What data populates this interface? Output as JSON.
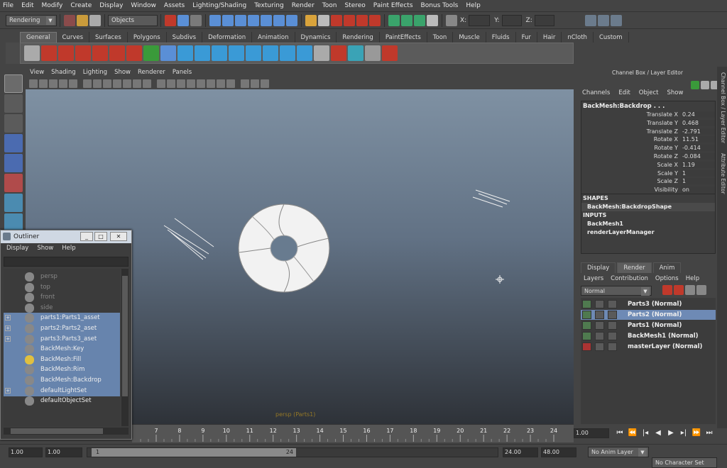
{
  "menubar": [
    "File",
    "Edit",
    "Modify",
    "Create",
    "Display",
    "Window",
    "Assets",
    "Lighting/Shading",
    "Texturing",
    "Render",
    "Toon",
    "Stereo",
    "Paint Effects",
    "Bonus Tools",
    "Help"
  ],
  "status": {
    "mode": "Rendering",
    "selection_mask": "Objects",
    "x_label": "X:",
    "y_label": "Y:",
    "z_label": "Z:"
  },
  "shelf_tabs": [
    "General",
    "Curves",
    "Surfaces",
    "Polygons",
    "Subdivs",
    "Deformation",
    "Animation",
    "Dynamics",
    "Rendering",
    "PaintEffects",
    "Toon",
    "Muscle",
    "Fluids",
    "Fur",
    "Hair",
    "nCloth",
    "Custom"
  ],
  "viewport": {
    "menu": [
      "View",
      "Shading",
      "Lighting",
      "Show",
      "Renderer",
      "Panels"
    ],
    "camera_label": "persp (Parts1)"
  },
  "channel_box": {
    "title": "Channel Box / Layer Editor",
    "menu": [
      "Channels",
      "Edit",
      "Object",
      "Show"
    ],
    "object": "BackMesh:Backdrop . . .",
    "attrs": [
      {
        "name": "Translate X",
        "value": "0.24"
      },
      {
        "name": "Translate Y",
        "value": "0.468"
      },
      {
        "name": "Translate Z",
        "value": "-2.791"
      },
      {
        "name": "Rotate X",
        "value": "11.51"
      },
      {
        "name": "Rotate Y",
        "value": "-0.414"
      },
      {
        "name": "Rotate Z",
        "value": "-0.084"
      },
      {
        "name": "Scale X",
        "value": "1.19"
      },
      {
        "name": "Scale Y",
        "value": "1"
      },
      {
        "name": "Scale Z",
        "value": "1"
      },
      {
        "name": "Visibility",
        "value": "on"
      }
    ],
    "shapes_header": "SHAPES",
    "shape": "BackMesh:BackdropShape",
    "inputs_header": "INPUTS",
    "inputs": [
      "BackMesh1",
      "renderLayerManager"
    ]
  },
  "side_tabs": [
    "Channel Box / Layer Editor",
    "Attribute Editor"
  ],
  "layer_editor": {
    "tabs": [
      "Display",
      "Render",
      "Anim"
    ],
    "active_tab": "Render",
    "menu": [
      "Layers",
      "Contribution",
      "Options",
      "Help"
    ],
    "blend_mode": "Normal",
    "layers": [
      {
        "name": "Parts3 (Normal)",
        "selected": false
      },
      {
        "name": "Parts2 (Normal)",
        "selected": true
      },
      {
        "name": "Parts1 (Normal)",
        "selected": false
      },
      {
        "name": "BackMesh1 (Normal)",
        "selected": false
      },
      {
        "name": "masterLayer (Normal)",
        "selected": false
      }
    ]
  },
  "outliner": {
    "title": "Outliner",
    "menu": [
      "Display",
      "Show",
      "Help"
    ],
    "items": [
      {
        "name": "persp",
        "selected": false,
        "dim": true,
        "expandable": false
      },
      {
        "name": "top",
        "selected": false,
        "dim": true,
        "expandable": false
      },
      {
        "name": "front",
        "selected": false,
        "dim": true,
        "expandable": false
      },
      {
        "name": "side",
        "selected": false,
        "dim": true,
        "expandable": false
      },
      {
        "name": "parts1:Parts1_asset",
        "selected": true,
        "dim": false,
        "expandable": true
      },
      {
        "name": "parts2:Parts2_aset",
        "selected": true,
        "dim": false,
        "expandable": true
      },
      {
        "name": "parts3:Parts3_aset",
        "selected": true,
        "dim": false,
        "expandable": true
      },
      {
        "name": "BackMesh:Key",
        "selected": true,
        "dim": false,
        "expandable": false
      },
      {
        "name": "BackMesh:Fill",
        "selected": true,
        "dim": false,
        "expandable": false
      },
      {
        "name": "BackMesh:Rim",
        "selected": true,
        "dim": false,
        "expandable": false
      },
      {
        "name": "BackMesh:Backdrop",
        "selected": true,
        "dim": false,
        "expandable": false
      },
      {
        "name": "defaultLightSet",
        "selected": true,
        "dim": false,
        "expandable": true
      },
      {
        "name": "defaultObjectSet",
        "selected": false,
        "dim": false,
        "expandable": false
      }
    ]
  },
  "time_slider": {
    "ticks": [
      "7",
      "8",
      "9",
      "10",
      "11",
      "12",
      "13",
      "14",
      "15",
      "16",
      "17",
      "18",
      "19",
      "20",
      "21",
      "22",
      "23",
      "24"
    ],
    "current_time": "1.00"
  },
  "range_slider": {
    "start": "1.00",
    "playback_start": "1.00",
    "range_start_label": "1",
    "range_end_label": "24",
    "playback_end": "24.00",
    "end": "48.00",
    "anim_layer": "No Anim Layer",
    "character_set": "No Character Set"
  }
}
